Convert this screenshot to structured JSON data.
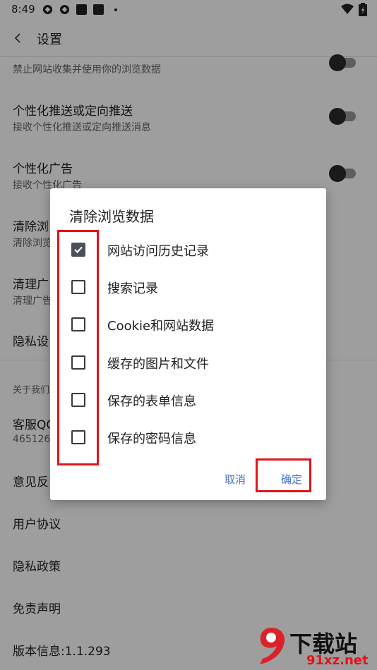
{
  "status_bar": {
    "time": "8:49"
  },
  "header": {
    "title": "设置"
  },
  "settings": [
    {
      "subtitle": "禁止网站收集并使用你的浏览数据"
    },
    {
      "title": "个性化推送或定向推送",
      "subtitle": "接收个性化推送或定向推送消息"
    },
    {
      "title": "个性化广告",
      "subtitle": "接收个性化广告"
    },
    {
      "title": "清除浏",
      "subtitle": "清除浏览"
    },
    {
      "title": "清理广",
      "subtitle": "清理广告"
    },
    {
      "title": "隐私设"
    }
  ],
  "section_about": "关于我们",
  "about_items": [
    {
      "title": "客服QQ",
      "subtitle": "465126"
    },
    {
      "title": "意见反"
    },
    {
      "title": "用户协议"
    },
    {
      "title": "隐私政策"
    },
    {
      "title": "免责声明"
    },
    {
      "title": "版本信息:1.1.293"
    }
  ],
  "dialog": {
    "title": "清除浏览数据",
    "options": [
      {
        "label": "网站访问历史记录",
        "checked": true
      },
      {
        "label": "搜索记录",
        "checked": false
      },
      {
        "label": "Cookie和网站数据",
        "checked": false
      },
      {
        "label": "缓存的图片和文件",
        "checked": false
      },
      {
        "label": "保存的表单信息",
        "checked": false
      },
      {
        "label": "保存的密码信息",
        "checked": false
      }
    ],
    "cancel_label": "取消",
    "confirm_label": "确定"
  },
  "watermark": {
    "text": "下载站",
    "url_text": "91xz.net"
  },
  "colors": {
    "accent": "#3e6fd6",
    "highlight": "#e1141b",
    "checkbox": "#4a4f5c",
    "overlay": "rgba(0,0,0,0.38)"
  },
  "icons": [
    "status-icon",
    "back-chevron-icon",
    "wifi-icon",
    "battery-icon",
    "checkmark-icon"
  ]
}
